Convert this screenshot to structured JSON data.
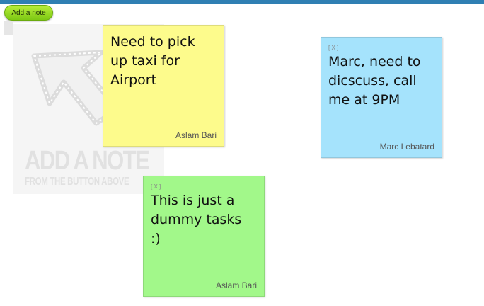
{
  "toolbar": {
    "add_note_label": "Add a note"
  },
  "hint": {
    "title": "ADD A NOTE",
    "subtitle": "FROM THE BUTTON ABOVE",
    "icon": "arrow-up-left-icon"
  },
  "notes": [
    {
      "text": "Need to pick\nup taxi for\nAirport",
      "author": "Aslam Bari",
      "color": "#fdfb8c"
    },
    {
      "close": "[ X ]",
      "text": "Marc, need to\ndicscuss, call\nme at 9PM",
      "author": "Marc Lebatard",
      "color": "#a5e3fc"
    },
    {
      "close": "[ X ]",
      "text": "This is just a\ndummy tasks\n:)",
      "author": "Aslam Bari",
      "color": "#a2f88a"
    }
  ],
  "colors": {
    "accent": "#2f7fb3",
    "button": "#9ad726"
  }
}
